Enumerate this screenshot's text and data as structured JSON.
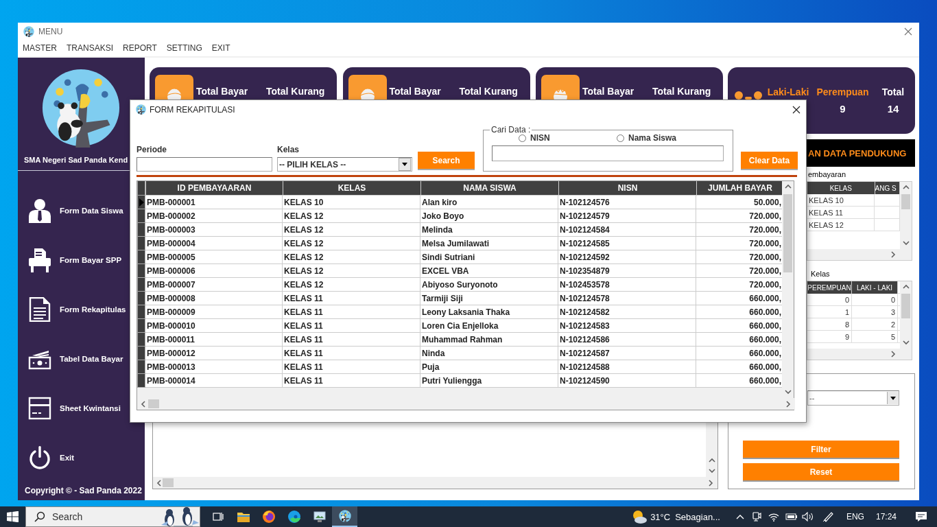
{
  "window": {
    "title": "MENU"
  },
  "menu": [
    "MASTER",
    "TRANSAKSI",
    "REPORT",
    "SETTING",
    "EXIT"
  ],
  "sidebar": {
    "school": "SMA Negeri Sad Panda Kend",
    "items": [
      {
        "label": "Form Data Siswa",
        "kind": "user"
      },
      {
        "label": "Form Bayar SPP",
        "kind": "printer"
      },
      {
        "label": "Form Rekapitulas",
        "kind": "document"
      },
      {
        "label": "Tabel Data Bayar",
        "kind": "money"
      },
      {
        "label": "Sheet Kwintansi",
        "kind": "card"
      },
      {
        "label": "Exit",
        "kind": "power"
      }
    ],
    "copyright": "Copyright © - Sad Panda 2022"
  },
  "summary_cards": [
    {
      "kind": "female",
      "labels": [
        "Total Bayar",
        "Total Kurang"
      ]
    },
    {
      "kind": "female",
      "labels": [
        "Total Bayar",
        "Total Kurang"
      ]
    },
    {
      "kind": "male",
      "labels": [
        "Total Bayar",
        "Total Kurang"
      ]
    }
  ],
  "gender_card": {
    "stats": [
      {
        "label": "Laki-Laki",
        "color": "#ff8c1a"
      },
      {
        "label": "Perempuan",
        "value": "9",
        "color": "#ff8c1a"
      },
      {
        "label": "Total",
        "value": "14",
        "color": "#ffffff"
      }
    ]
  },
  "side_panel": {
    "banner": "AN DATA PENDUKUNG",
    "table_1": {
      "caption": "embayaran",
      "columns": [
        "KELAS",
        "ANG S"
      ],
      "rows": [
        "KELAS 10",
        "KELAS 11",
        "KELAS 12"
      ]
    },
    "table_2": {
      "caption": "Kelas",
      "columns": [
        "PEREMPUAN",
        "LAKI - LAKI"
      ],
      "rows": [
        [
          "0",
          "0"
        ],
        [
          "1",
          "3"
        ],
        [
          "8",
          "2"
        ],
        [
          "9",
          "5"
        ]
      ]
    },
    "filter_box": {
      "select_value": "--",
      "buttons": [
        "Filter",
        "Reset"
      ]
    }
  },
  "dialog": {
    "title": "FORM REKAPITULASI",
    "periode": {
      "label": "Periode"
    },
    "kelas": {
      "label": "Kelas",
      "value": "-- PILIH KELAS --"
    },
    "search_button": "Search",
    "cari_data": {
      "legend": "Cari Data :",
      "options": [
        {
          "label": "NISN",
          "selected": false
        },
        {
          "label": "Nama Siswa",
          "selected": false
        }
      ]
    },
    "clear_button": "Clear Data",
    "grid": {
      "columns": [
        "ID PEMBAYAARAN",
        "KELAS",
        "NAMA SISWA",
        "NISN",
        "JUMLAH BAYAR"
      ],
      "rows": [
        {
          "cells": [
            "PMB-000001",
            "KELAS 10",
            "Alan kiro",
            "N-102124576",
            "50.000,"
          ],
          "selected": true
        },
        {
          "cells": [
            "PMB-000002",
            "KELAS 12",
            "Joko Boyo",
            "N-102124579",
            "720.000,"
          ],
          "selected": false
        },
        {
          "cells": [
            "PMB-000003",
            "KELAS 12",
            "Melinda",
            "N-102124584",
            "720.000,"
          ],
          "selected": false
        },
        {
          "cells": [
            "PMB-000004",
            "KELAS 12",
            "Melsa Jumilawati",
            "N-102124585",
            "720.000,"
          ],
          "selected": false
        },
        {
          "cells": [
            "PMB-000005",
            "KELAS 12",
            "Sindi Sutriani",
            "N-102124592",
            "720.000,"
          ],
          "selected": false
        },
        {
          "cells": [
            "PMB-000006",
            "KELAS 12",
            "EXCEL VBA",
            "N-102354879",
            "720.000,"
          ],
          "selected": false
        },
        {
          "cells": [
            "PMB-000007",
            "KELAS 12",
            "Abiyoso Suryonoto",
            "N-102453578",
            "720.000,"
          ],
          "selected": false
        },
        {
          "cells": [
            "PMB-000008",
            "KELAS 11",
            "Tarmiji Siji",
            "N-102124578",
            "660.000,"
          ],
          "selected": false
        },
        {
          "cells": [
            "PMB-000009",
            "KELAS 11",
            "Leony Laksania Thaka",
            "N-102124582",
            "660.000,"
          ],
          "selected": false
        },
        {
          "cells": [
            "PMB-000010",
            "KELAS 11",
            "Loren Cia Enjelloka",
            "N-102124583",
            "660.000,"
          ],
          "selected": false
        },
        {
          "cells": [
            "PMB-000011",
            "KELAS 11",
            "Muhammad Rahman",
            "N-102124586",
            "660.000,"
          ],
          "selected": false
        },
        {
          "cells": [
            "PMB-000012",
            "KELAS 11",
            "Ninda",
            "N-102124587",
            "660.000,"
          ],
          "selected": false
        },
        {
          "cells": [
            "PMB-000013",
            "KELAS 11",
            "Puja",
            "N-102124588",
            "660.000,"
          ],
          "selected": false
        },
        {
          "cells": [
            "PMB-000014",
            "KELAS 11",
            "Putri Yuliengga",
            "N-102124590",
            "660.000,"
          ],
          "selected": false
        }
      ]
    }
  },
  "taskbar": {
    "search_placeholder": "Search",
    "apps": [
      {
        "kind": "taskview",
        "active": false
      },
      {
        "kind": "explorer",
        "active": false
      },
      {
        "kind": "firefox",
        "active": false
      },
      {
        "kind": "edge",
        "active": false
      },
      {
        "kind": "monitor",
        "active": false
      },
      {
        "kind": "python",
        "active": true
      }
    ],
    "temperature": "31°C",
    "weather": "Sebagian...",
    "language": "ENG",
    "time": "17:24"
  }
}
